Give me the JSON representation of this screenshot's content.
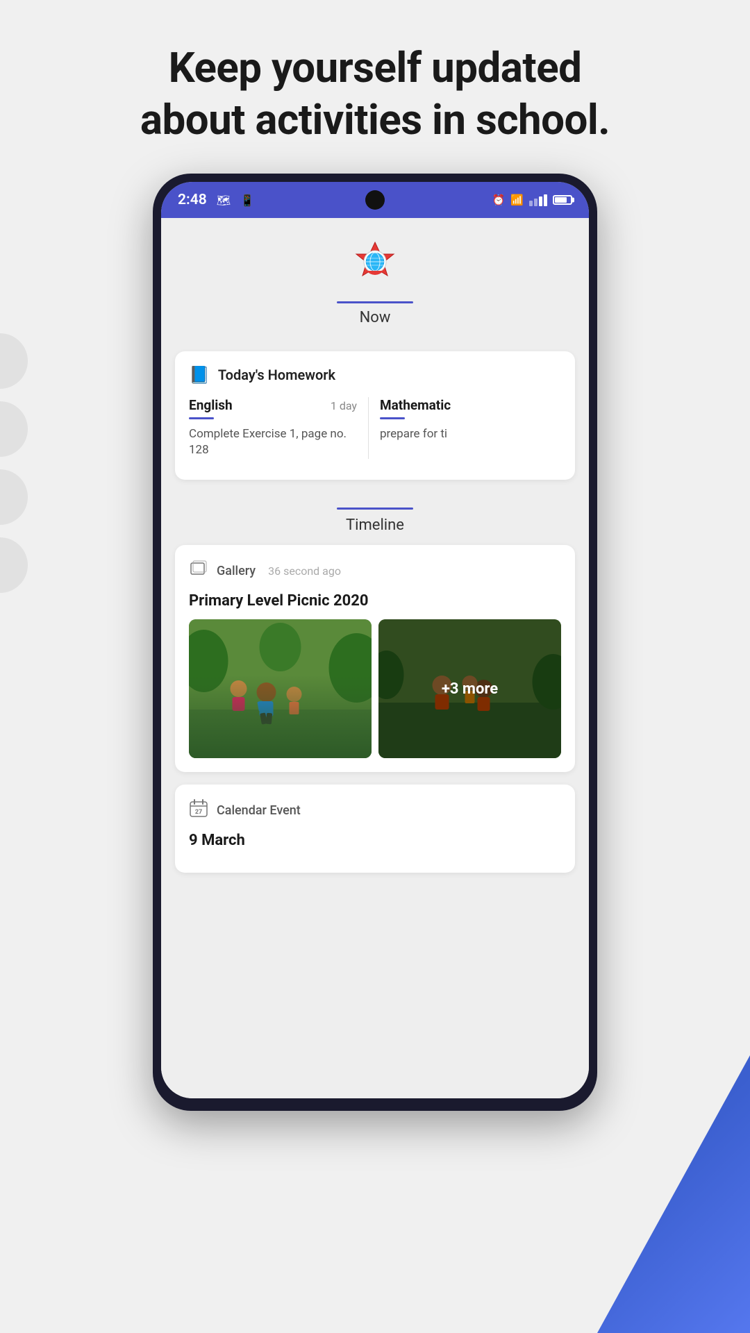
{
  "header": {
    "title_line1": "Keep yourself updated",
    "title_line2": "about activities in school."
  },
  "status_bar": {
    "time": "2:48",
    "icons": [
      "maps",
      "whatsapp",
      "alarm",
      "wifi",
      "signal",
      "battery"
    ]
  },
  "school_section": {
    "now_label": "Now"
  },
  "homework": {
    "section_title": "Today's Homework",
    "subjects": [
      {
        "name": "English",
        "due": "1 day",
        "description": "Complete Exercise 1, page no. 128"
      },
      {
        "name": "Mathematic",
        "due": "",
        "description": "prepare for ti"
      }
    ]
  },
  "timeline": {
    "label": "Timeline",
    "items": [
      {
        "type": "Gallery",
        "time": "36 second ago",
        "title": "Primary Level Picnic 2020",
        "more_photos": "+3 more"
      },
      {
        "type": "Calendar Event",
        "date": "9 March"
      }
    ]
  }
}
